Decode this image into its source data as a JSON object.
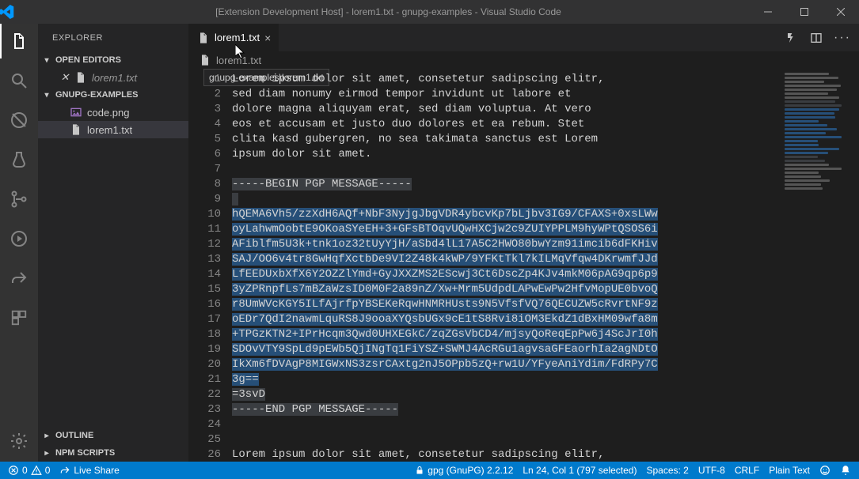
{
  "titlebar": {
    "title": "[Extension Development Host] - lorem1.txt - gnupg-examples - Visual Studio Code"
  },
  "sidebar": {
    "title": "Explorer",
    "open_editors": {
      "label": "Open Editors",
      "items": [
        {
          "icon": "✕",
          "name": "lorem1.txt"
        }
      ]
    },
    "workspace": {
      "label": "gnupg-examples",
      "items": [
        {
          "icon": "img",
          "name": "code.png"
        },
        {
          "icon": "txt",
          "name": "lorem1.txt"
        }
      ]
    },
    "outline": {
      "label": "Outline"
    },
    "npm": {
      "label": "NPM Scripts"
    }
  },
  "tab": {
    "file": "lorem1.txt"
  },
  "breadcrumb": {
    "file": "lorem1.txt",
    "tooltip": "gnupg-examples\\lorem1.txt"
  },
  "code_lines": [
    "Lorem ipsum dolor sit amet, consetetur sadipscing elitr,",
    "sed diam nonumy eirmod tempor invidunt ut labore et",
    "dolore magna aliquyam erat, sed diam voluptua. At vero",
    "eos et accusam et justo duo dolores et ea rebum. Stet",
    "clita kasd gubergren, no sea takimata sanctus est Lorem",
    "ipsum dolor sit amet.",
    "",
    "-----BEGIN PGP MESSAGE-----",
    "",
    "hQEMA6Vh5/zzXdH6AQf+NbF3NyjgJbgVDR4ybcvKp7bLjbv3IG9/CFAXS+0xsLWw",
    "oyLahwmOobtE9OKoaSYeEH+3+GFsBTOqvUQwHXCjw2c9ZUIYPPLM9hyWPtQSOS6i",
    "AFiblfm5U3k+tnk1oz32tUyYjH/aSbd4lL17A5C2HWO80bwYzm91imcib6dFKHiv",
    "SAJ/OO6v4tr8GwHqfXctbDe9VI2Z48k4kWP/9YFKtTkl7kILMqVfqw4DKrwmfJJd",
    "LfEEDUxbXfX6Y2OZZlYmd+GyJXXZMS2EScwj3Ct6DscZp4KJv4mkM06pAG9qp6p9",
    "3yZPRnpfLs7mBZaWzsID0M0F2a89nZ/Xw+Mrm5UdpdLAPwEwPw2HfvMopUE0bvoQ",
    "r8UmWVcKGY5ILfAjrfpYBSEKeRqwHNMRHUsts9N5VfsfVQ76QECUZW5cRvrtNF9z",
    "oEDr7QdI2nawmLquRS8J9ooaXYQsbUGx9cE1tS8Rvi8iOM3EkdZ1dBxHM09wfa8m",
    "+TPGzKTN2+IPrHcqm3Qwd0UHXEGkC/zqZGsVbCD4/mjsyQoReqEpPw6j4ScJrI0h",
    "SDOvVTY9SpLd9pEWb5QjINgTq1FiYSZ+SWMJ4AcRGu1agvsaGFEaorhIa2agNDtO",
    "IkXm6fDVAgP8MIGWxNS3zsrCAxtg2nJ5OPpb5zQ+rw1U/YFyeAniYdim/FdRPy7C",
    "3g==",
    "=3svD",
    "-----END PGP MESSAGE-----",
    "",
    "",
    "Lorem ipsum dolor sit amet, consetetur sadipscing elitr,"
  ],
  "selection": {
    "dim": [
      8,
      23
    ],
    "full": [
      10,
      21
    ]
  },
  "status": {
    "errors": "0",
    "warnings": "0",
    "live_share": "Live Share",
    "gpg": "gpg (GnuPG) 2.2.12",
    "position": "Ln 24, Col 1 (797 selected)",
    "spaces": "Spaces: 2",
    "encoding": "UTF-8",
    "eol": "CRLF",
    "language": "Plain Text"
  }
}
